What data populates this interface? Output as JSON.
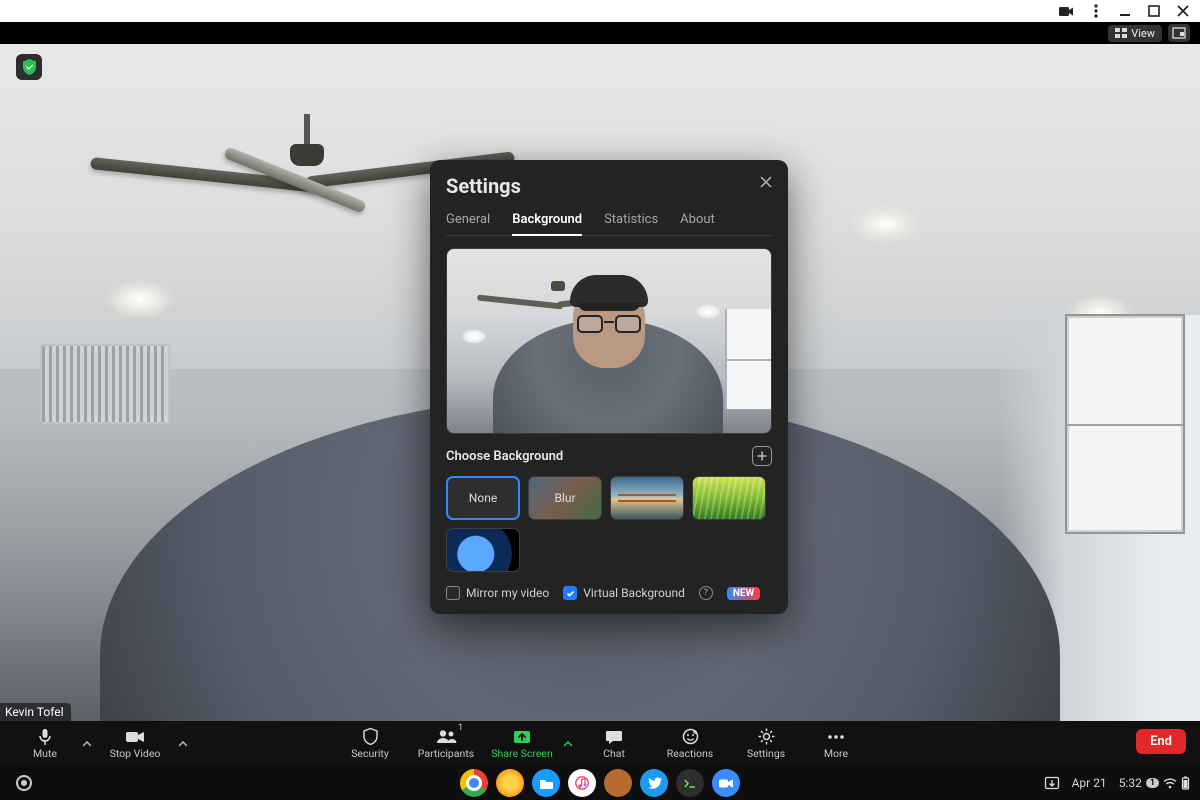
{
  "osbar": {
    "icons": [
      "camera",
      "kebab",
      "minimize",
      "maximize",
      "close"
    ]
  },
  "topstrip": {
    "view_label": "View"
  },
  "participant_name": "Kevin Tofel",
  "modal": {
    "title": "Settings",
    "tabs": [
      "General",
      "Background",
      "Statistics",
      "About"
    ],
    "active_tab": "Background",
    "choose_label": "Choose Background",
    "options": [
      {
        "id": "none",
        "label": "None",
        "selected": true
      },
      {
        "id": "blur",
        "label": "Blur"
      },
      {
        "id": "bridge",
        "label": ""
      },
      {
        "id": "grass",
        "label": ""
      },
      {
        "id": "earth",
        "label": ""
      }
    ],
    "mirror_label": "Mirror my video",
    "mirror_checked": false,
    "virtual_label": "Virtual Background",
    "virtual_checked": true,
    "new_badge": "NEW"
  },
  "meetbar": {
    "mute": "Mute",
    "stop_video": "Stop Video",
    "security": "Security",
    "participants": "Participants",
    "participants_count": "1",
    "share": "Share Screen",
    "chat": "Chat",
    "reactions": "Reactions",
    "settings": "Settings",
    "more": "More",
    "end": "End"
  },
  "taskbar": {
    "date": "Apr 21",
    "time": "5:32",
    "notif_count": "1"
  }
}
